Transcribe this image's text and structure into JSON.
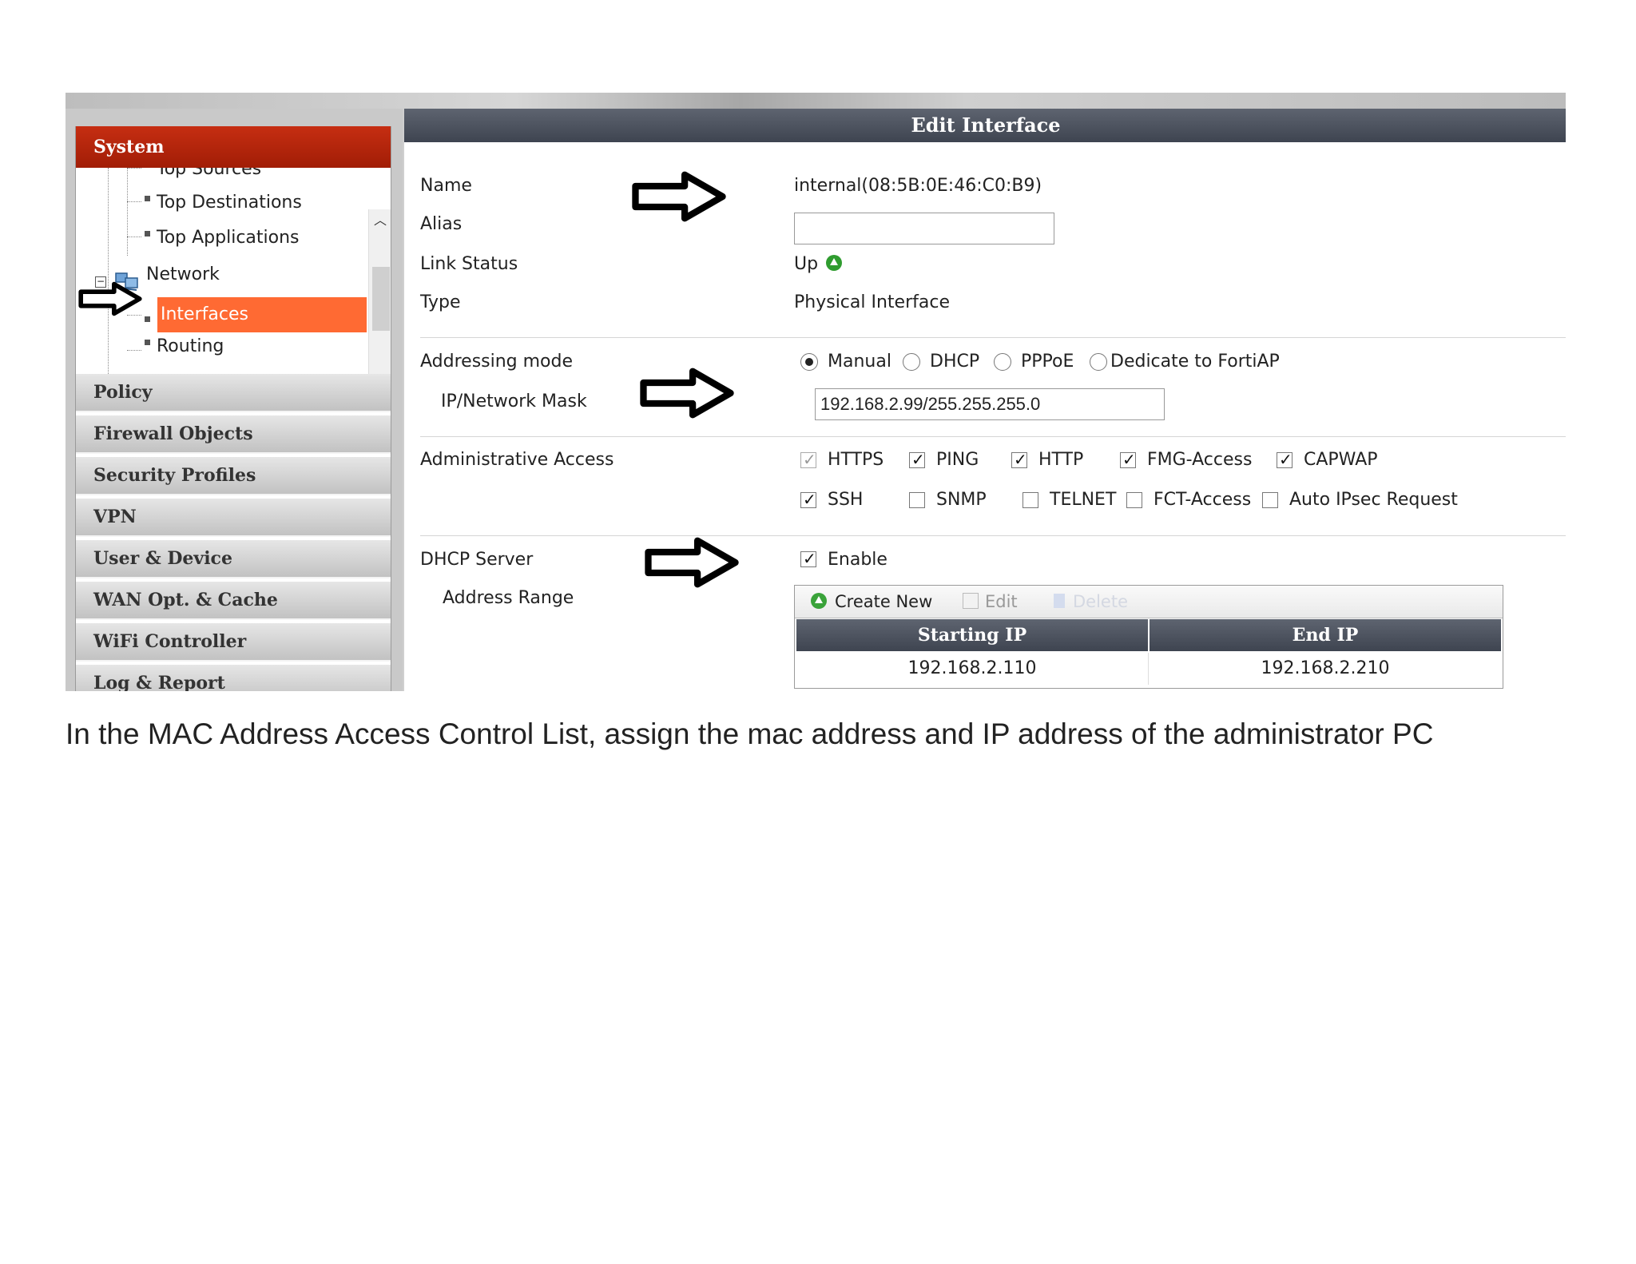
{
  "sidebar": {
    "header": "System",
    "tree": {
      "top_sources": "Top Sources",
      "top_destinations": "Top Destinations",
      "top_applications": "Top Applications",
      "network": "Network",
      "interfaces": "Interfaces",
      "routing": "Routing"
    },
    "menu": [
      "Policy",
      "Firewall Objects",
      "Security Profiles",
      "VPN",
      "User & Device",
      "WAN Opt. & Cache",
      "WiFi Controller",
      "Log & Report"
    ]
  },
  "panel": {
    "title": "Edit Interface",
    "name_label": "Name",
    "name_value": "internal(08:5B:0E:46:C0:B9)",
    "alias_label": "Alias",
    "alias_value": "",
    "link_status_label": "Link Status",
    "link_status_value": "Up",
    "type_label": "Type",
    "type_value": "Physical Interface",
    "addressing_mode_label": "Addressing mode",
    "addressing_modes": [
      "Manual",
      "DHCP",
      "PPPoE",
      "Dedicate to FortiAP"
    ],
    "addressing_mode_selected": "Manual",
    "ip_mask_label": "IP/Network Mask",
    "ip_mask_value": "192.168.2.99/255.255.255.0",
    "admin_access_label": "Administrative Access",
    "admin_access": [
      {
        "label": "HTTPS",
        "checked": true
      },
      {
        "label": "PING",
        "checked": true
      },
      {
        "label": "HTTP",
        "checked": true
      },
      {
        "label": "FMG-Access",
        "checked": true
      },
      {
        "label": "CAPWAP",
        "checked": true
      },
      {
        "label": "SSH",
        "checked": true
      },
      {
        "label": "SNMP",
        "checked": false
      },
      {
        "label": "TELNET",
        "checked": false
      },
      {
        "label": "FCT-Access",
        "checked": false
      },
      {
        "label": "Auto IPsec Request",
        "checked": false
      }
    ],
    "dhcp_server_label": "DHCP Server",
    "dhcp_enable_label": "Enable",
    "address_range_label": "Address Range",
    "toolbar": {
      "create_new": "Create New",
      "edit": "Edit",
      "delete": "Delete"
    },
    "range_table": {
      "columns": [
        "Starting IP",
        "End IP"
      ],
      "rows": [
        [
          "192.168.2.110",
          "192.168.2.210"
        ]
      ]
    }
  },
  "caption": "In the MAC Address Access Control List, assign the mac address and IP address of the administrator PC",
  "colors": {
    "system_header": "#b3250b",
    "selected_item": "#ff6a33",
    "panel_header": "#4a505c",
    "link_up": "#2f9c2f"
  }
}
